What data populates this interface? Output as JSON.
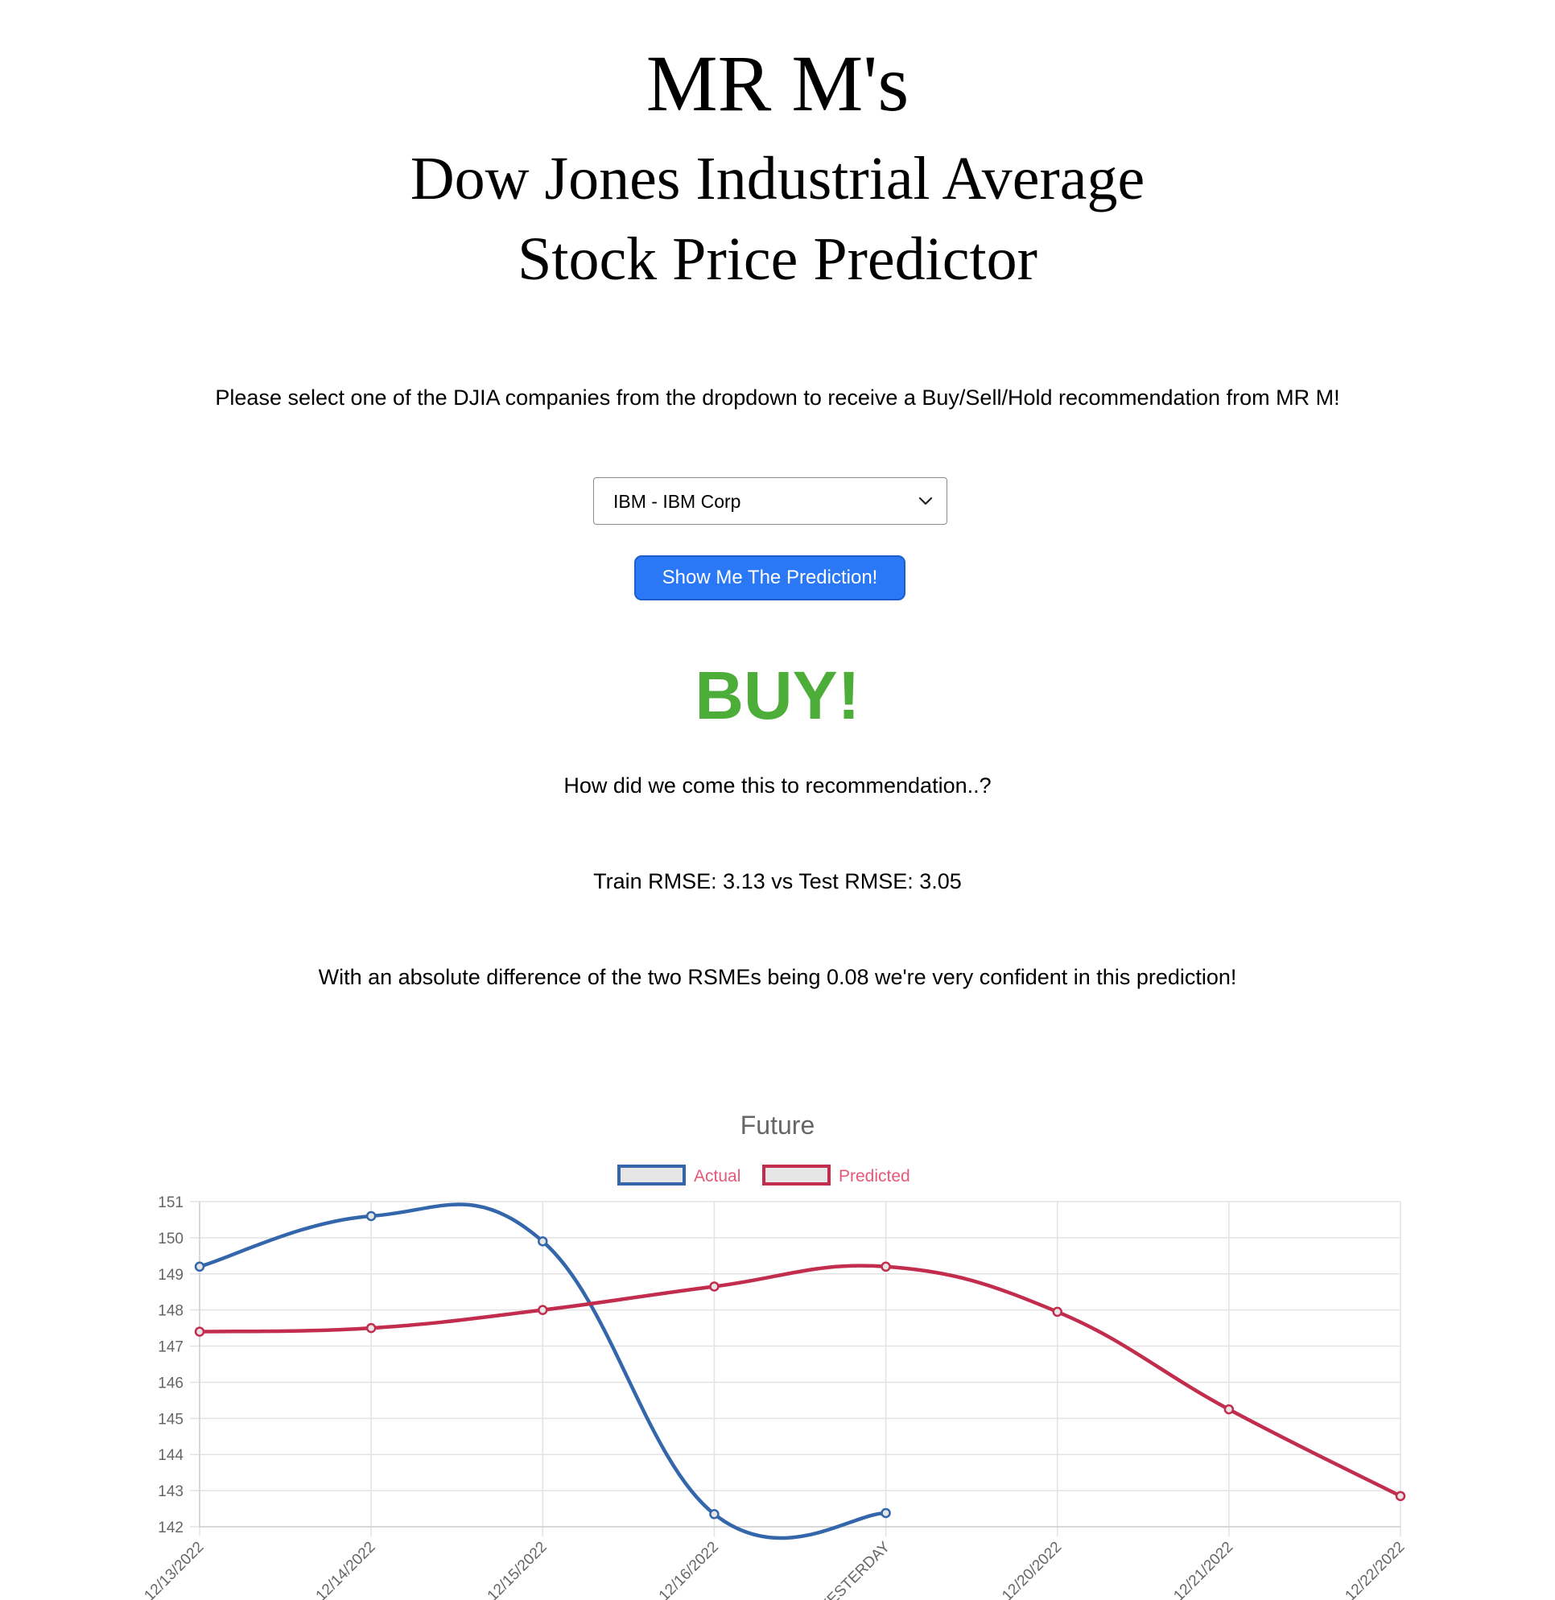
{
  "header": {
    "title": "MR M's",
    "subtitle_line1": "Dow Jones Industrial Average",
    "subtitle_line2": "Stock Price Predictor"
  },
  "instructions": "Please select one of the DJIA companies from the dropdown to receive a Buy/Sell/Hold recommendation from MR M!",
  "company_select": {
    "selected": "IBM - IBM Corp"
  },
  "predict_button": {
    "label": "Show Me The Prediction!"
  },
  "result": {
    "recommendation": "BUY!",
    "recommendation_color": "#4cad38",
    "explanation_heading": "How did we come this to recommendation..?",
    "rmse_line": "Train RMSE: 3.13 vs Test RMSE: 3.05",
    "confidence_line": "With an absolute difference of the two RSMEs being 0.08 we're very confident in this prediction!"
  },
  "chart_data": {
    "type": "line",
    "title": "Future",
    "categories": [
      "12/13/2022",
      "12/14/2022",
      "12/15/2022",
      "12/16/2022",
      "YESTERDAY",
      "12/20/2022",
      "12/21/2022",
      "12/22/2022"
    ],
    "series": [
      {
        "name": "Actual",
        "color": "#3366aa",
        "values": [
          149.2,
          150.6,
          149.9,
          142.35,
          142.38,
          null,
          null,
          null
        ]
      },
      {
        "name": "Predicted",
        "color": "#c22c4d",
        "values": [
          147.4,
          147.5,
          148.0,
          148.65,
          149.2,
          147.95,
          145.25,
          142.85
        ]
      }
    ],
    "ylim": [
      142,
      151
    ],
    "yticks": [
      142,
      143,
      144,
      145,
      146,
      147,
      148,
      149,
      150,
      151
    ],
    "grid": true,
    "legend_position": "top",
    "legend_text_color": "#e8577a",
    "title_color": "#666666",
    "tick_color": "#666666"
  }
}
